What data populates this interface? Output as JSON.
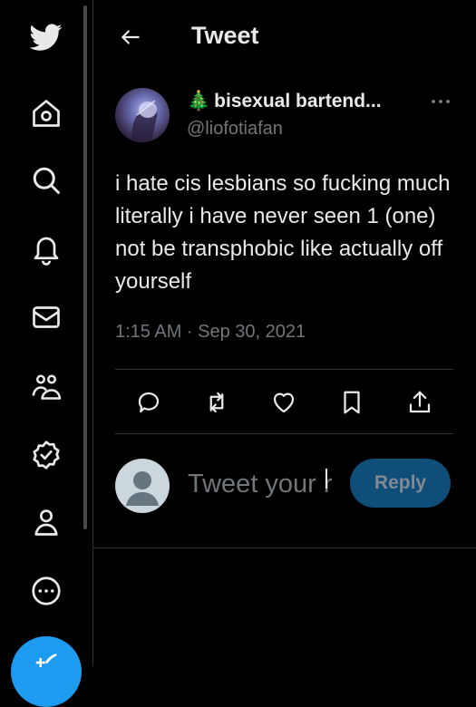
{
  "header": {
    "title": "Tweet"
  },
  "sidebar": {
    "items": [
      {
        "icon": "twitter-bird-icon"
      },
      {
        "icon": "home-icon"
      },
      {
        "icon": "search-icon"
      },
      {
        "icon": "bell-icon"
      },
      {
        "icon": "mail-icon"
      },
      {
        "icon": "communities-icon"
      },
      {
        "icon": "verified-icon"
      },
      {
        "icon": "profile-icon"
      },
      {
        "icon": "more-circle-icon"
      },
      {
        "icon": "compose-icon"
      }
    ]
  },
  "tweet": {
    "display_emoji": "🎄",
    "display_name": "bisexual bartend...",
    "handle": "@liofotiafan",
    "text": "i hate cis lesbians so fucking much literally i have never seen 1 (one) not be transphobic like actually off yourself",
    "timestamp": "1:15 AM · Sep 30, 2021"
  },
  "reply": {
    "placeholder": "Tweet your reply",
    "button_label": "Reply"
  },
  "colors": {
    "background": "#000000",
    "text": "#e7e9ea",
    "secondary": "#71767b",
    "accent": "#1d9bf0",
    "divider": "#2f3336"
  }
}
